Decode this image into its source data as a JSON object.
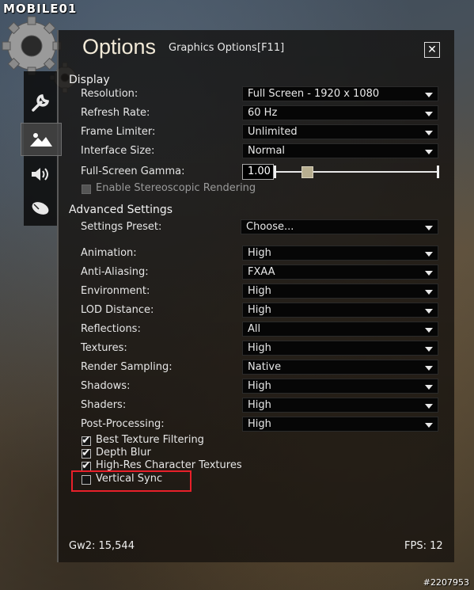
{
  "watermark": "MOBILE01",
  "photo_id": "#2207953",
  "window": {
    "title": "Options",
    "subtitle": "Graphics Options",
    "hotkey": "[F11]",
    "close_label": "✕"
  },
  "sidebar": {
    "tabs": [
      {
        "icon": "wrench-icon",
        "active": false
      },
      {
        "icon": "mountain-icon",
        "active": true
      },
      {
        "icon": "speaker-icon",
        "active": false
      },
      {
        "icon": "mouse-icon",
        "active": false
      }
    ]
  },
  "display": {
    "heading": "Display",
    "resolution": {
      "label": "Resolution:",
      "value": "Full Screen - 1920 x 1080"
    },
    "refresh_rate": {
      "label": "Refresh Rate:",
      "value": "60 Hz"
    },
    "frame_limiter": {
      "label": "Frame Limiter:",
      "value": "Unlimited"
    },
    "interface_size": {
      "label": "Interface Size:",
      "value": "Normal"
    },
    "gamma": {
      "label": "Full-Screen Gamma:",
      "value": "1.00",
      "slider_fraction": 0.2
    },
    "stereo": {
      "label": "Enable Stereoscopic Rendering",
      "checked": false,
      "enabled": false
    }
  },
  "advanced": {
    "heading": "Advanced Settings",
    "preset": {
      "label": "Settings Preset:",
      "value": "Choose..."
    },
    "animation": {
      "label": "Animation:",
      "value": "High"
    },
    "anti_aliasing": {
      "label": "Anti-Aliasing:",
      "value": "FXAA"
    },
    "environment": {
      "label": "Environment:",
      "value": "High"
    },
    "lod_distance": {
      "label": "LOD Distance:",
      "value": "High"
    },
    "reflections": {
      "label": "Reflections:",
      "value": "All"
    },
    "textures": {
      "label": "Textures:",
      "value": "High"
    },
    "render_sampling": {
      "label": "Render Sampling:",
      "value": "Native"
    },
    "shadows": {
      "label": "Shadows:",
      "value": "High"
    },
    "shaders": {
      "label": "Shaders:",
      "value": "High"
    },
    "post_processing": {
      "label": "Post-Processing:",
      "value": "High"
    },
    "best_texture": {
      "label": "Best Texture Filtering",
      "checked": true
    },
    "depth_blur": {
      "label": "Depth Blur",
      "checked": true
    },
    "highres_char": {
      "label": "High-Res Character Textures",
      "checked": true
    },
    "vsync": {
      "label": "Vertical Sync",
      "checked": false
    }
  },
  "footer": {
    "build": "Gw2: 15,544",
    "fps": "FPS: 12"
  },
  "colors": {
    "highlight": "#e8202a",
    "title": "#f2ead8"
  }
}
